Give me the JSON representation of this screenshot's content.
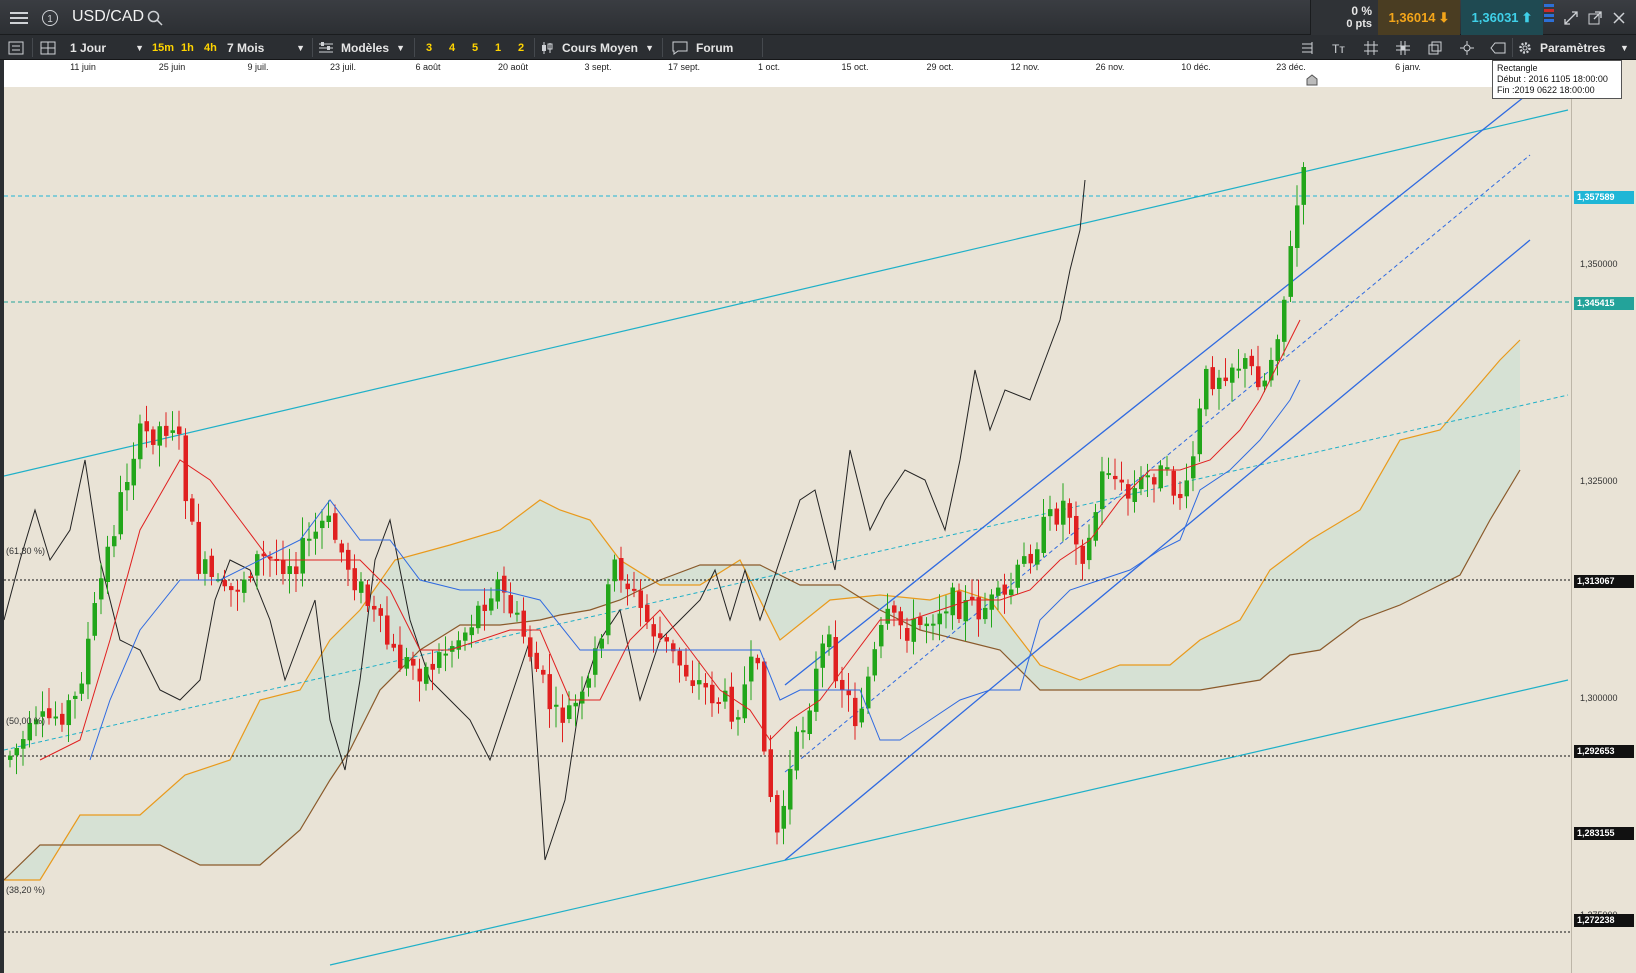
{
  "topbar": {
    "title": "USD/CAD",
    "change_pct": "0 %",
    "change_pts": "0 pts",
    "bid": "1,36014",
    "ask": "1,36031",
    "colors": {
      "bid_bg": "#4a3d22",
      "ask_bg": "#1f4a52",
      "bid_fg": "#f3a51a",
      "ask_fg": "#3fd0e8"
    }
  },
  "toolbar": {
    "period": "1 Jour",
    "intervals": [
      "15m",
      "1h",
      "4h"
    ],
    "range": "7 Mois",
    "templates": "Modèles",
    "quick": [
      "3",
      "4",
      "5",
      "1",
      "2"
    ],
    "price_type": "Cours Moyen",
    "forum": "Forum",
    "settings": "Paramètres"
  },
  "dates": [
    "11 juin",
    "25 juin",
    "9 juil.",
    "23 juil.",
    "6 août",
    "20 août",
    "3 sept.",
    "17 sept.",
    "1 oct.",
    "15 oct.",
    "29 oct.",
    "12 nov.",
    "26 nov.",
    "10 déc.",
    "23 déc.",
    "6 janv."
  ],
  "tooltip": {
    "line1": "Rectangle",
    "line2": "Début : 2016 1105 18:00:00",
    "line3": "Fin :2019 0622 18:00:00"
  },
  "price_axis": {
    "ticks": [
      "1,350000",
      "1,325000",
      "1,300000",
      "1,275000"
    ],
    "tags": [
      {
        "value": "1,357589",
        "color": "#1fb6d6"
      },
      {
        "value": "1,345415",
        "color": "#23a39a"
      },
      {
        "value": "1,313067",
        "color": "#111111"
      },
      {
        "value": "1,292653",
        "color": "#111111"
      },
      {
        "value": "1,283155",
        "color": "#111111"
      },
      {
        "value": "1,272238",
        "color": "#111111"
      }
    ]
  },
  "fib_labels": [
    "(61,80 %)",
    "(50,00 %)",
    "(38,20 %)"
  ],
  "chart_data": {
    "type": "candlestick",
    "ylim": [
      1.265,
      1.372
    ],
    "candles_seed": 7,
    "last_close": 1.3576
  }
}
